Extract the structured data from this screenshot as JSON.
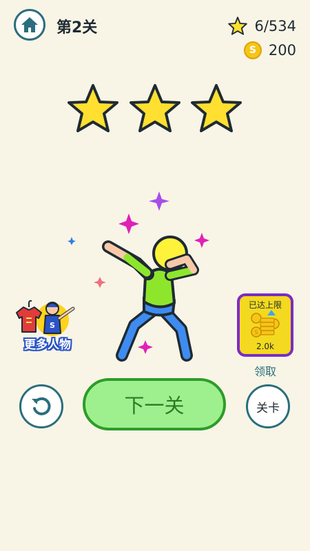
{
  "header": {
    "level_title": "第2关",
    "stars_count": "6/534",
    "coins_count": "200",
    "coin_symbol": "S"
  },
  "result": {
    "stars_earned": 3,
    "stars_total": 3,
    "star_color": "#ffe030"
  },
  "more_characters": {
    "label": "更多人物"
  },
  "reward": {
    "status": "已达上限",
    "amount": "2.0k",
    "claim_label": "领取"
  },
  "buttons": {
    "next_level": "下一关",
    "levels": "关卡"
  },
  "colors": {
    "background": "#f8f5e6",
    "accent": "#2b6e7e",
    "next_button_fill": "#9ef08f",
    "next_button_border": "#2e9c28",
    "reward_card": "#f3d91f",
    "reward_border": "#7b2cc4"
  }
}
